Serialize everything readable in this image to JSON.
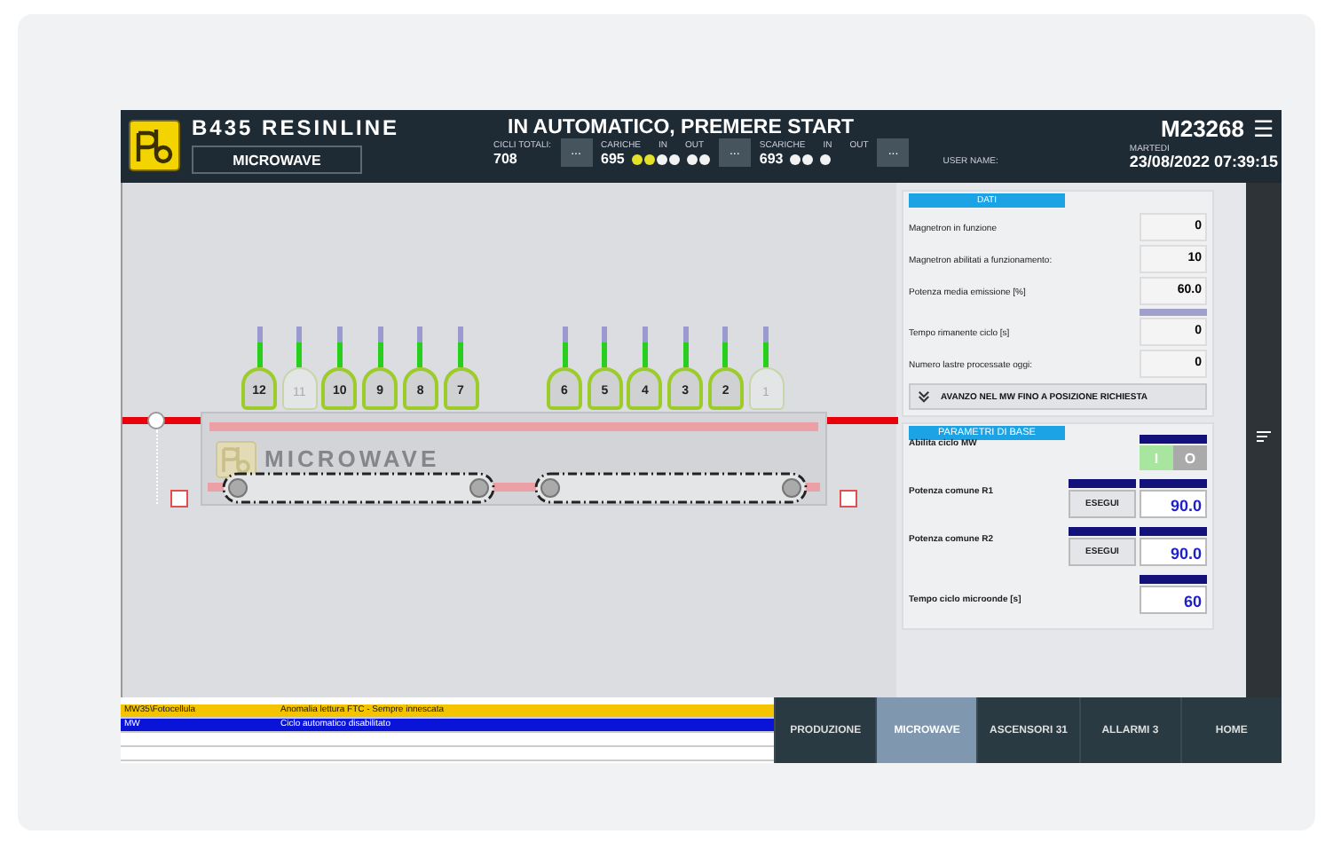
{
  "header": {
    "line": "B435 RESINLINE",
    "status": "IN AUTOMATICO, PREMERE START",
    "machine": "M23268",
    "menu_glyph": "☰",
    "page_button": "MICROWAVE",
    "counters": [
      {
        "kind": "value",
        "label": "CICLI TOTALI:",
        "value": "708"
      },
      {
        "kind": "more",
        "value": "..."
      },
      {
        "kind": "dots",
        "label": "CARICHE",
        "value": "695",
        "groups": [
          {
            "label": "IN",
            "dots": [
              {
                "on": true
              },
              {
                "on": true
              },
              {
                "on": false
              },
              {
                "on": false
              }
            ]
          },
          {
            "label": "OUT",
            "dots": [
              {
                "on": false
              },
              {
                "on": false
              }
            ]
          }
        ]
      },
      {
        "kind": "more",
        "value": "..."
      },
      {
        "kind": "dots",
        "label": "SCARICHE",
        "value": "693",
        "groups": [
          {
            "label": "IN",
            "dots": [
              {
                "on": false
              },
              {
                "on": false
              }
            ]
          },
          {
            "label": "OUT",
            "dots": [
              {
                "on": false
              }
            ]
          }
        ]
      },
      {
        "kind": "more",
        "value": "..."
      },
      {
        "kind": "user",
        "label": "USER NAME:"
      }
    ],
    "day": "MARTEDI",
    "datetime": "23/08/2022 07:39:15"
  },
  "machine": {
    "title": "MICROWAVE",
    "left_nozzles": [
      {
        "number": "12",
        "active": true,
        "level": 0.6
      },
      {
        "number": "11",
        "active": false,
        "level": 0.6
      },
      {
        "number": "10",
        "active": true,
        "level": 0.6
      },
      {
        "number": "9",
        "active": true,
        "level": 0.6
      },
      {
        "number": "8",
        "active": true,
        "level": 0.6
      },
      {
        "number": "7",
        "active": true,
        "level": 0.6
      }
    ],
    "right_nozzles": [
      {
        "number": "6",
        "active": true,
        "level": 0.6
      },
      {
        "number": "5",
        "active": true,
        "level": 0.6
      },
      {
        "number": "4",
        "active": true,
        "level": 0.6
      },
      {
        "number": "3",
        "active": true,
        "level": 0.6
      },
      {
        "number": "2",
        "active": true,
        "level": 0.6
      },
      {
        "number": "1",
        "active": false,
        "level": 0.6
      }
    ]
  },
  "dati": {
    "title": "DATI",
    "rows": [
      {
        "label": "Magnetron in funzione",
        "value": "0"
      },
      {
        "label": "Magnetron abilitati a funzionamento:",
        "value": "10"
      },
      {
        "label": "Potenza media emissione [%]",
        "value": "60.0"
      },
      {
        "label": "Tempo rimanente ciclo [s]",
        "value": "0",
        "level": 1
      },
      {
        "label": "Numero lastre processate oggi:",
        "value": "0"
      }
    ],
    "advance_button": "AVANZO NEL MW FINO A POSIZIONE RICHIESTA"
  },
  "parametri": {
    "title": "PARAMETRI DI BASE",
    "items": [
      {
        "kind": "toggle",
        "label": "Abilita ciclo MW",
        "on": true,
        "on_label": "I",
        "off_label": "O"
      },
      {
        "kind": "power",
        "label": "Potenza comune R1",
        "button": "ESEGUI",
        "value": "90.0"
      },
      {
        "kind": "power",
        "label": "Potenza comune R2",
        "button": "ESEGUI",
        "value": "90.0"
      },
      {
        "kind": "value",
        "label": "Tempo ciclo microonde [s]",
        "value": "60"
      }
    ]
  },
  "alarms": [
    {
      "color": "#f5c400",
      "source": "MW35\\Fotocellula",
      "message": "Anomalia lettura FTC - Sempre innescata"
    },
    {
      "color": "#0a14d8",
      "source": "MW",
      "message": "Ciclo automatico disabilitato"
    }
  ],
  "tabs": [
    {
      "label": "PRODUZIONE",
      "selected": false
    },
    {
      "label": "MICROWAVE",
      "selected": true
    },
    {
      "label": "ASCENSORI 31",
      "selected": false
    },
    {
      "label": "ALLARMI 3",
      "selected": false
    },
    {
      "label": "HOME",
      "selected": false
    }
  ]
}
